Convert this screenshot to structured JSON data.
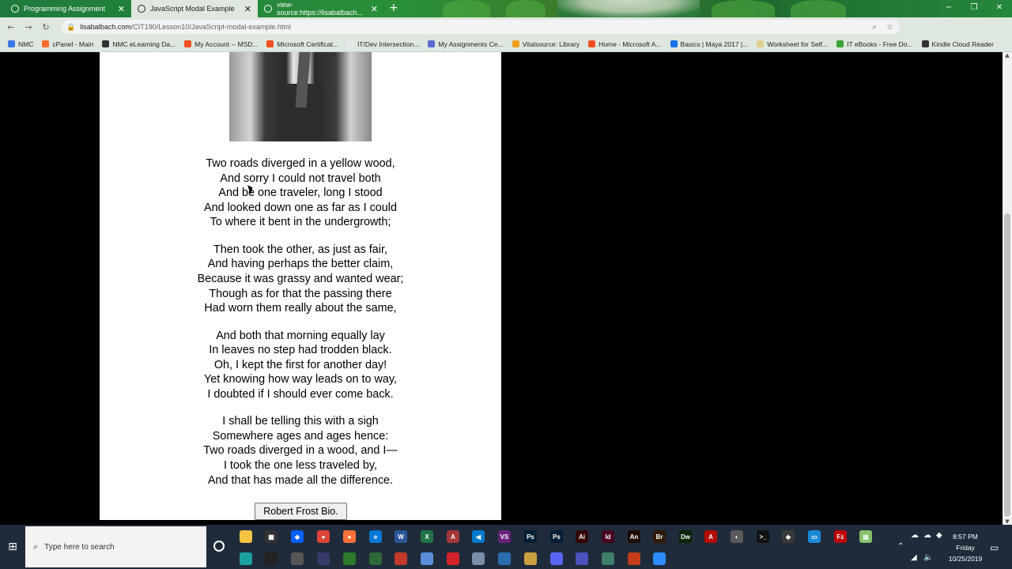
{
  "browser": {
    "tabs": [
      {
        "label": "Programming Assignment",
        "active": false
      },
      {
        "label": "JavaScript Modal Example",
        "active": true
      },
      {
        "label": "view-source:https://lisabalbach...",
        "active": false
      }
    ],
    "new_tab": "+",
    "window_controls": [
      "−",
      "❐",
      "✕"
    ],
    "url_host": "lisabalbach.com",
    "url_path": "/CIT190/Lesson10/JavaScript-modal-example.html",
    "bookmarks": [
      {
        "label": "NMC",
        "color": "#3b78e7"
      },
      {
        "label": "cPanel - Main",
        "color": "#ff6c2c"
      },
      {
        "label": "NMC eLearning Da...",
        "color": "#333333"
      },
      {
        "label": "My Account -- MSD...",
        "color": "#f25022"
      },
      {
        "label": "Microsoft Certificat...",
        "color": "#f25022"
      },
      {
        "label": "IT/Dev Intersection...",
        "color": "#e8e8e8"
      },
      {
        "label": "My Assignments Ce...",
        "color": "#5b6ad0"
      },
      {
        "label": "Vitalsource: Library",
        "color": "#f0a020"
      },
      {
        "label": "Home - Microsoft A...",
        "color": "#f25022"
      },
      {
        "label": "Basics | Maya 2017 |...",
        "color": "#1a73e8"
      },
      {
        "label": "Worksheet for Self...",
        "color": "#e0d090"
      },
      {
        "label": "IT eBooks - Free Do...",
        "color": "#3aa43a"
      },
      {
        "label": "Kindle Cloud Reader",
        "color": "#333333"
      }
    ]
  },
  "poem": {
    "stanzas": [
      [
        "Two roads diverged in a yellow wood,",
        "And sorry I could not travel both",
        "And be one traveler, long I stood",
        "And looked down one as far as I could",
        "To where it bent in the undergrowth;"
      ],
      [
        "Then took the other, as just as fair,",
        "And having perhaps the better claim,",
        "Because it was grassy and wanted wear;",
        "Though as for that the passing there",
        "Had worn them really about the same,"
      ],
      [
        "And both that morning equally lay",
        "In leaves no step had trodden black.",
        "Oh, I kept the first for another day!",
        "Yet knowing how way leads on to way,",
        "I doubted if I should ever come back."
      ],
      [
        "I shall be telling this with a sigh",
        "Somewhere ages and ages hence:",
        "Two roads diverged in a wood, and I—",
        "I took the one less traveled by,",
        "And that has made all the difference."
      ]
    ]
  },
  "bio_button": "Robert Frost Bio.",
  "taskbar": {
    "search_placeholder": "Type here to search",
    "time": "8:57 PM",
    "day": "Friday",
    "date": "10/25/2019",
    "apps": [
      {
        "name": "file-explorer-icon",
        "label": "",
        "color": "#f5c342"
      },
      {
        "name": "calculator-icon",
        "label": "▦",
        "color": "#333"
      },
      {
        "name": "dropbox-icon",
        "label": "◆",
        "color": "#0061fe"
      },
      {
        "name": "chrome-icon",
        "label": "●",
        "color": "#db4437"
      },
      {
        "name": "firefox-icon",
        "label": "●",
        "color": "#ff7139"
      },
      {
        "name": "edge-icon",
        "label": "e",
        "color": "#0078d7"
      },
      {
        "name": "word-icon",
        "label": "W",
        "color": "#2b579a"
      },
      {
        "name": "excel-icon",
        "label": "X",
        "color": "#217346"
      },
      {
        "name": "access-icon",
        "label": "A",
        "color": "#a4373a"
      },
      {
        "name": "vscode-icon",
        "label": "◀",
        "color": "#007acc"
      },
      {
        "name": "visual-studio-icon",
        "label": "VS",
        "color": "#68217a"
      },
      {
        "name": "photoshop-icon",
        "label": "Ps",
        "color": "#001e36"
      },
      {
        "name": "photoshop2-icon",
        "label": "Ps",
        "color": "#001e36"
      },
      {
        "name": "illustrator-icon",
        "label": "Ai",
        "color": "#330000"
      },
      {
        "name": "indesign-icon",
        "label": "Id",
        "color": "#49021f"
      },
      {
        "name": "animate-icon",
        "label": "An",
        "color": "#1c0a00"
      },
      {
        "name": "bridge-icon",
        "label": "Br",
        "color": "#2e1a00"
      },
      {
        "name": "dreamweaver-icon",
        "label": "Dw",
        "color": "#072401"
      },
      {
        "name": "acrobat-icon",
        "label": "A",
        "color": "#b30b00"
      },
      {
        "name": "app-icon",
        "label": "◐",
        "color": "#5a5a5a"
      },
      {
        "name": "terminal-icon",
        "label": ">_",
        "color": "#111"
      },
      {
        "name": "app2-icon",
        "label": "◆",
        "color": "#3a3a3a"
      },
      {
        "name": "app3-icon",
        "label": "▭",
        "color": "#1a8ad4"
      },
      {
        "name": "filezilla-icon",
        "label": "Fz",
        "color": "#bf0000"
      },
      {
        "name": "notepad-icon",
        "label": "▤",
        "color": "#86c06c"
      }
    ]
  }
}
